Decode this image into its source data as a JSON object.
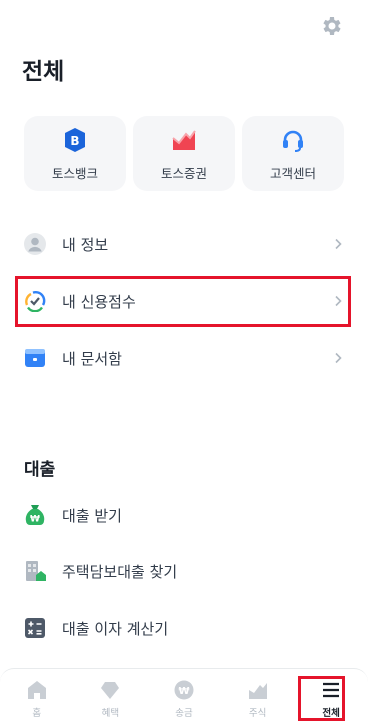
{
  "header": {
    "title": "전체",
    "settings_icon": "gear-icon"
  },
  "quick_actions": [
    {
      "label": "토스뱅크",
      "icon": "bank-b-icon",
      "color": "#1b64da"
    },
    {
      "label": "토스증권",
      "icon": "stock-chart-icon",
      "color": "#f04452"
    },
    {
      "label": "고객센터",
      "icon": "headset-icon",
      "color": "#3182f6"
    }
  ],
  "account_menu": [
    {
      "label": "내 정보",
      "icon": "profile-icon"
    },
    {
      "label": "내 신용점수",
      "icon": "credit-gauge-icon"
    },
    {
      "label": "내 문서함",
      "icon": "document-box-icon"
    }
  ],
  "loan_section": {
    "title": "대출",
    "items": [
      {
        "label": "대출 받기",
        "icon": "money-bag-icon"
      },
      {
        "label": "주택담보대출 찾기",
        "icon": "building-icon"
      },
      {
        "label": "대출 이자 계산기",
        "icon": "calculator-icon"
      }
    ]
  },
  "tabbar": [
    {
      "label": "홈",
      "icon": "home-icon"
    },
    {
      "label": "혜택",
      "icon": "gem-icon"
    },
    {
      "label": "송금",
      "icon": "won-transfer-icon"
    },
    {
      "label": "주식",
      "icon": "stock-icon"
    },
    {
      "label": "전체",
      "icon": "menu-icon",
      "active": true
    }
  ],
  "colors": {
    "accent": "#3182f6",
    "highlight": "#e5142b",
    "loan_green": "#2fb463"
  }
}
